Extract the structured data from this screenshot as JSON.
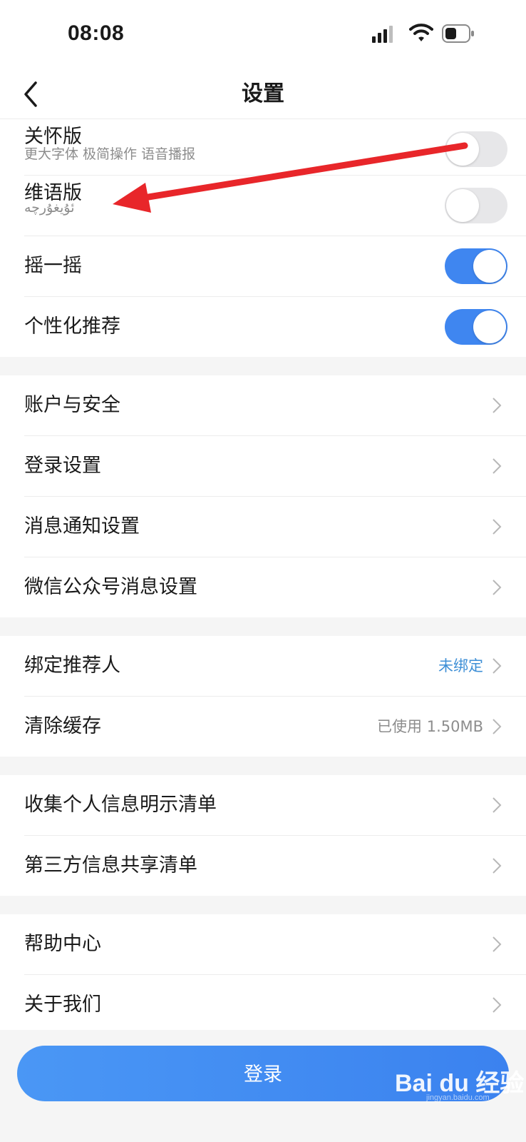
{
  "status_bar": {
    "time": "08:08"
  },
  "nav": {
    "title": "设置"
  },
  "groups": {
    "features": [
      {
        "label": "关怀版",
        "sub": "更大字体 极简操作 语音播报",
        "on": false
      },
      {
        "label": "维语版",
        "sub": "ئۇيغۇرچە",
        "on": false
      },
      {
        "label": "摇一摇",
        "on": true
      },
      {
        "label": "个性化推荐",
        "on": true
      }
    ],
    "account": [
      {
        "label": "账户与安全"
      },
      {
        "label": "登录设置"
      },
      {
        "label": "消息通知设置"
      },
      {
        "label": "微信公众号消息设置"
      }
    ],
    "misc": [
      {
        "label": "绑定推荐人",
        "value": "未绑定"
      },
      {
        "label": "清除缓存",
        "value": "已使用 1.50MB"
      }
    ],
    "privacy": [
      {
        "label": "收集个人信息明示清单"
      },
      {
        "label": "第三方信息共享清单"
      }
    ],
    "help": [
      {
        "label": "帮助中心"
      },
      {
        "label": "关于我们"
      }
    ]
  },
  "login": {
    "label": "登录"
  },
  "watermark": {
    "text": "Bai du 经验",
    "sub": "jingyan.baidu.com"
  },
  "colors": {
    "accent": "#3f86f0",
    "annotation_arrow": "#e8262a",
    "link": "#3e8fd6"
  },
  "icons": [
    "signal-icon",
    "wifi-icon",
    "battery-icon",
    "back-arrow-icon",
    "chevron-right-icon"
  ]
}
